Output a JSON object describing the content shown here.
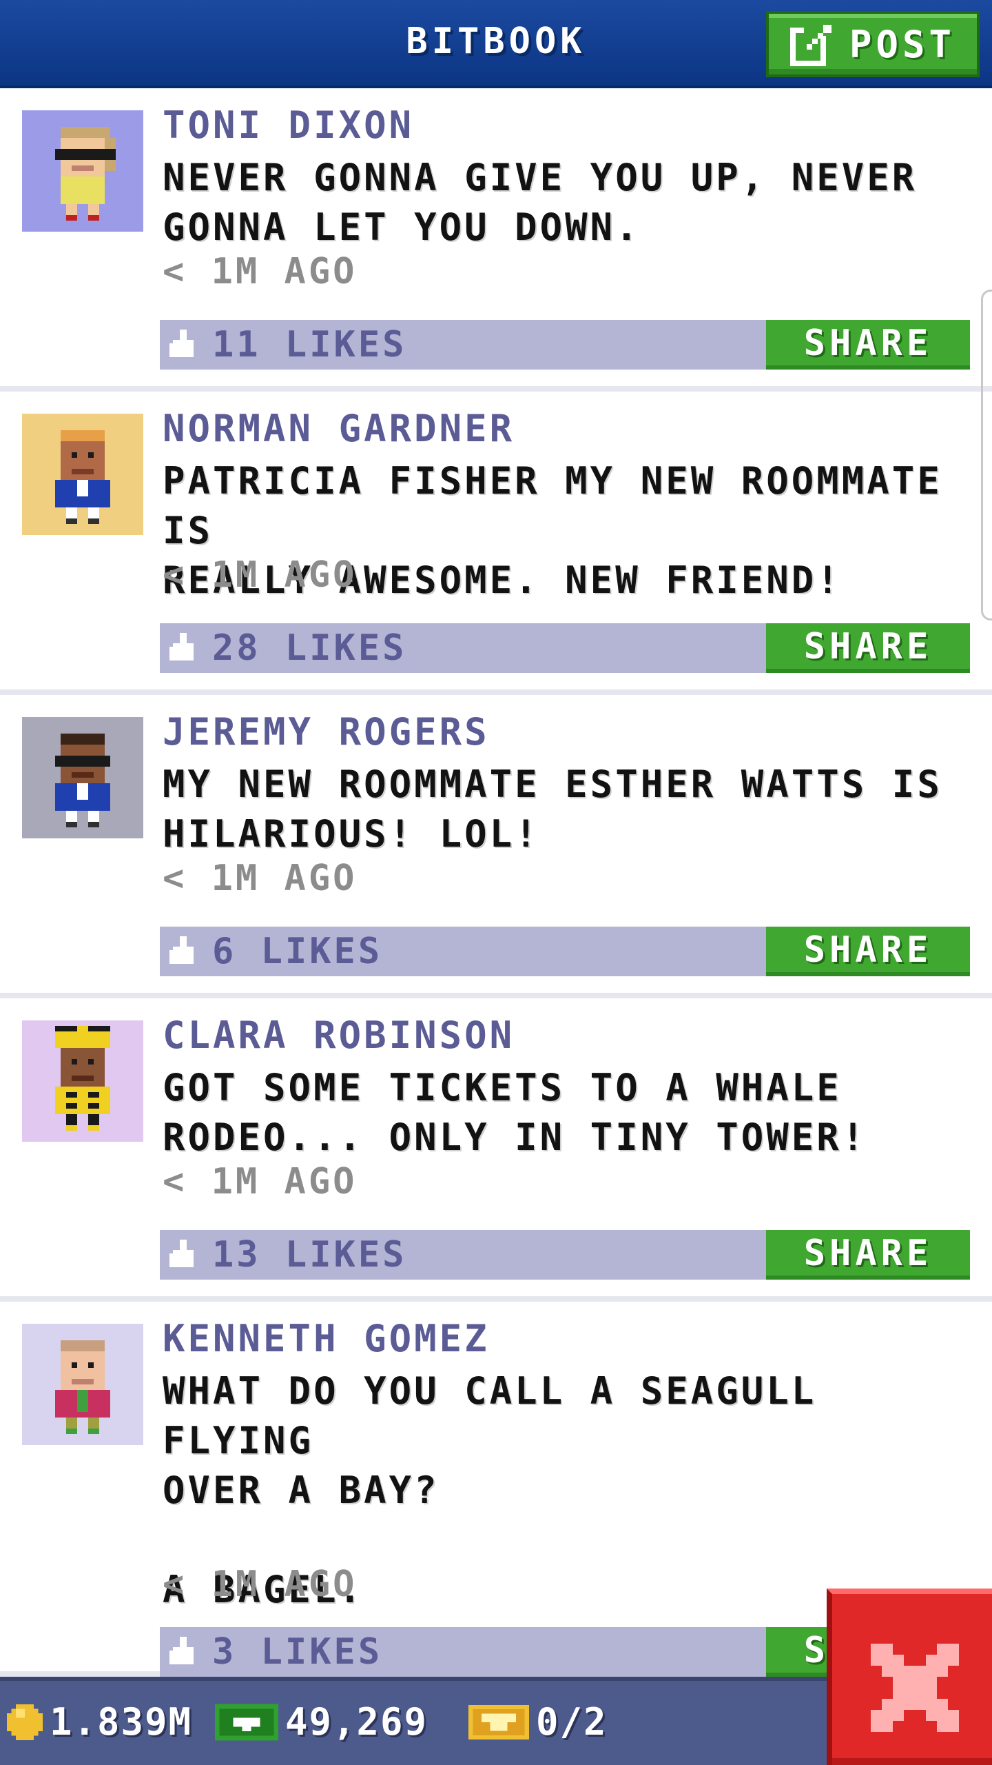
{
  "header": {
    "title": "BITBOOK",
    "post_label": "POST"
  },
  "posts": [
    {
      "name": "TONI DIXON",
      "text": "NEVER GONNA GIVE YOU UP, NEVER\nGONNA LET YOU DOWN.",
      "time": "< 1M AGO",
      "likes": "11 LIKES",
      "share": "SHARE"
    },
    {
      "name": "NORMAN GARDNER",
      "text": "PATRICIA FISHER MY NEW ROOMMATE IS\nREALLY AWESOME. NEW FRIEND!",
      "time": "< 1M AGO",
      "likes": "28 LIKES",
      "share": "SHARE"
    },
    {
      "name": "JEREMY ROGERS",
      "text": "MY NEW ROOMMATE ESTHER WATTS IS\nHILARIOUS! LOL!",
      "time": "< 1M AGO",
      "likes": "6 LIKES",
      "share": "SHARE"
    },
    {
      "name": "CLARA ROBINSON",
      "text": "GOT SOME TICKETS TO A WHALE\nRODEO... ONLY IN TINY TOWER!",
      "time": "< 1M AGO",
      "likes": "13 LIKES",
      "share": "SHARE"
    },
    {
      "name": "KENNETH GOMEZ",
      "text": "WHAT DO YOU CALL A SEAGULL FLYING\nOVER A BAY?\n\nA BAGEL.",
      "time": "< 1M AGO",
      "likes": "3 LIKES",
      "share": "SHARE"
    }
  ],
  "footer": {
    "coins": "1.839M",
    "bux": "49,269",
    "tickets": "0/2"
  },
  "icons": {
    "compose": "compose-icon",
    "like": "thumbs-up-icon",
    "coin": "coin-icon",
    "bux": "bux-icon",
    "ticket": "ticket-icon",
    "close": "close-icon"
  },
  "colors": {
    "header": "#0c3584",
    "accent_green": "#40a830",
    "likes_bar": "#b4b4d4",
    "name": "#5b5b96",
    "close_red": "#e02828",
    "footer": "#4d5a8c"
  }
}
